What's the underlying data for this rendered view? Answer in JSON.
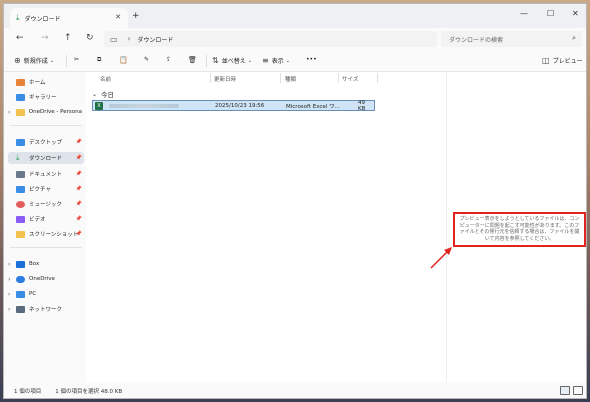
{
  "tab": {
    "title": "ダウンロード",
    "close": "✕",
    "new_tab": "+"
  },
  "window_controls": {
    "minimize": "—",
    "maximize": "☐",
    "close": "✕"
  },
  "nav": {
    "back": "←",
    "forward": "→",
    "up": "↑",
    "refresh": "↻"
  },
  "address": {
    "monitor_icon": "▭",
    "separator": "›",
    "path": "ダウンロード"
  },
  "search": {
    "placeholder": "ダウンロードの検索",
    "icon": "⌕"
  },
  "commands": {
    "new": "新規作成",
    "cut": "✂",
    "copy": "⧉",
    "paste": "📋",
    "rename": "✎",
    "share": "⇪",
    "delete": "🗑",
    "sort": "並べ替え",
    "view": "表示",
    "more": "•••",
    "preview": "プレビュー"
  },
  "sidebar": {
    "items": [
      {
        "label": "ホーム",
        "color": "#e8833a"
      },
      {
        "label": "ギャラリー",
        "color": "#3b8ee8"
      },
      {
        "label": "OneDrive - Persona",
        "color": "#f2c14e"
      },
      {
        "label": "デスクトップ",
        "color": "#3b8ee8"
      },
      {
        "label": "ダウンロード",
        "color": "#2a9d5c"
      },
      {
        "label": "ドキュメント",
        "color": "#6b7a8f"
      },
      {
        "label": "ピクチャ",
        "color": "#3b8ee8"
      },
      {
        "label": "ミュージック",
        "color": "#e35d5d"
      },
      {
        "label": "ビデオ",
        "color": "#8a5cf6"
      },
      {
        "label": "スクリーンショット",
        "color": "#f2c14e"
      },
      {
        "label": "Box",
        "color": "#1a6fd8"
      },
      {
        "label": "OneDrive",
        "color": "#2b7de0"
      },
      {
        "label": "PC",
        "color": "#3b8ee8"
      },
      {
        "label": "ネットワーク",
        "color": "#5a6b80"
      }
    ]
  },
  "columns": {
    "name": "名前",
    "date": "更新日時",
    "type": "種類",
    "size": "サイズ"
  },
  "group": {
    "label": "今日"
  },
  "file": {
    "date": "2025/10/23 19:56",
    "type": "Microsoft Excel ワ...",
    "size": "49 KB"
  },
  "preview_message": "プレビュー表示をしようとしているファイルは、コンピューターに問題を起こす可能性があります。このファイルとその発行元を信頼する場合は、ファイルを開いて内容を参照してください。",
  "status": {
    "count": "1 個の項目",
    "selected": "1 個の項目を選択 48.0 KB"
  },
  "accent": "#e0241f"
}
